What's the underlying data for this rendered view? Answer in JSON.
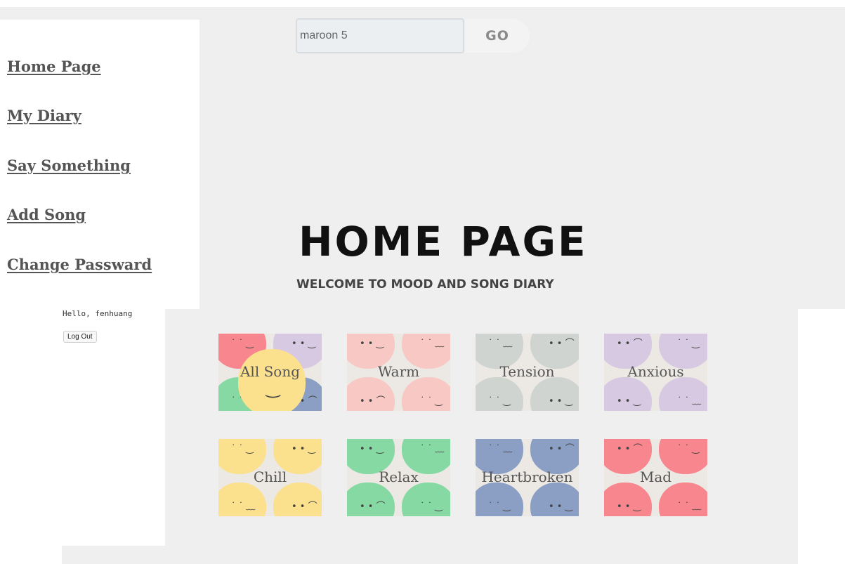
{
  "search": {
    "value": "maroon 5",
    "button_label": "GO"
  },
  "sidebar": {
    "items": [
      {
        "label": "Home Page"
      },
      {
        "label": "My Diary"
      },
      {
        "label": "Say Something"
      },
      {
        "label": "Add Song"
      },
      {
        "label": "Change Passward"
      }
    ]
  },
  "user": {
    "greeting": "Hello, fenhuang",
    "logout_label": "Log Out"
  },
  "header": {
    "title": "HOME PAGE",
    "subtitle": "WELCOME TO MOOD AND SONG DIARY"
  },
  "moods": [
    {
      "label": "All Song",
      "color": "#fbe08e"
    },
    {
      "label": "Warm",
      "color": "#f8c8c4"
    },
    {
      "label": "Tension",
      "color": "#d0d4d1"
    },
    {
      "label": "Anxious",
      "color": "#d8c9e2"
    },
    {
      "label": "Chill",
      "color": "#fbe08e"
    },
    {
      "label": "Relax",
      "color": "#86d9a3"
    },
    {
      "label": "Heartbroken",
      "color": "#8b9ec4"
    },
    {
      "label": "Mad",
      "color": "#f7868e"
    }
  ],
  "icons": {
    "mood_face": "face-icon"
  }
}
